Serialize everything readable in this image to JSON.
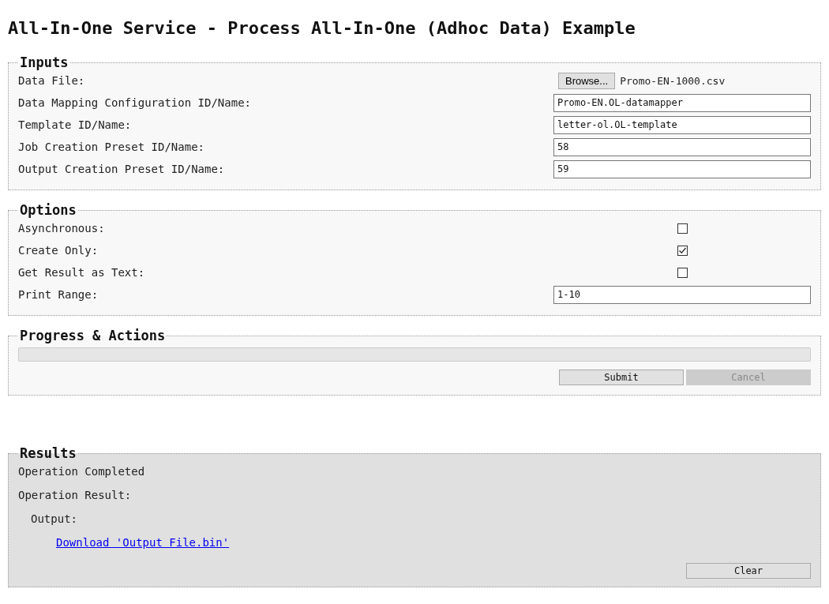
{
  "title": "All-In-One Service - Process All-In-One (Adhoc Data) Example",
  "inputs": {
    "legend": "Inputs",
    "rows": [
      {
        "kind": "file",
        "label": "Data File:",
        "button": "Browse...",
        "value": "Promo-EN-1000.csv"
      },
      {
        "kind": "text",
        "label": "Data Mapping Configuration ID/Name:",
        "value": "Promo-EN.OL-datamapper"
      },
      {
        "kind": "text",
        "label": "Template ID/Name:",
        "value": "letter-ol.OL-template"
      },
      {
        "kind": "text",
        "label": "Job Creation Preset ID/Name:",
        "value": "58"
      },
      {
        "kind": "text",
        "label": "Output Creation Preset ID/Name:",
        "value": "59"
      }
    ]
  },
  "options": {
    "legend": "Options",
    "rows": [
      {
        "kind": "checkbox",
        "label": "Asynchronous:",
        "checked": false
      },
      {
        "kind": "checkbox",
        "label": "Create Only:",
        "checked": true
      },
      {
        "kind": "checkbox",
        "label": "Get Result as Text:",
        "checked": false
      },
      {
        "kind": "text",
        "label": "Print Range:",
        "value": "1-10"
      }
    ]
  },
  "progress": {
    "legend": "Progress & Actions",
    "level": 0,
    "buttons": [
      {
        "label": "Submit",
        "disabled": false
      },
      {
        "label": "Cancel",
        "disabled": true
      }
    ]
  },
  "results": {
    "legend": "Results",
    "status": "Operation Completed",
    "result_label": "Operation Result:",
    "output_label": "Output:",
    "link": "Download 'Output File.bin'",
    "clear_button": "Clear"
  }
}
